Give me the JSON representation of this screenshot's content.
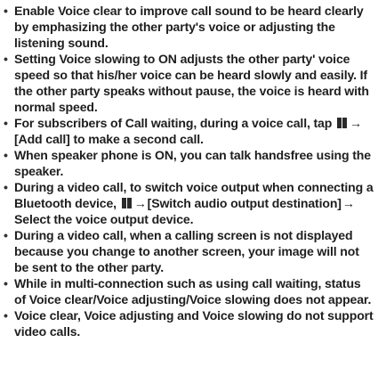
{
  "notes": {
    "bullet": "•",
    "menu_key_icon": "menu-key-icon",
    "arrow": "→",
    "item1": "Enable Voice clear to improve call sound to be heard clearly by emphasizing the other party's voice or adjusting the listening sound.",
    "item2": "Setting Voice slowing to ON adjusts the other party' voice speed so that his/her voice can be heard slowly and easily. If the other party speaks without pause, the voice is heard with normal speed.",
    "item3_a": "For subscribers of Call waiting, during a voice call, tap",
    "item3_b": "[Add call] to make a second call.",
    "item4": "When speaker phone is ON, you can talk handsfree using the speaker.",
    "item5_a": "During a video call, to switch voice output when connecting a Bluetooth device,",
    "item5_b": "[Switch audio output destination]",
    "item5_c": "Select the voice output device.",
    "item6": "During a video call, when a calling screen is not displayed because you change to another screen, your image will not be sent to the other party.",
    "item7": "While in multi-connection such as using call waiting, status of Voice clear/Voice adjusting/Voice slowing does not appear.",
    "item8": "Voice clear, Voice adjusting and Voice slowing do not support video calls."
  }
}
